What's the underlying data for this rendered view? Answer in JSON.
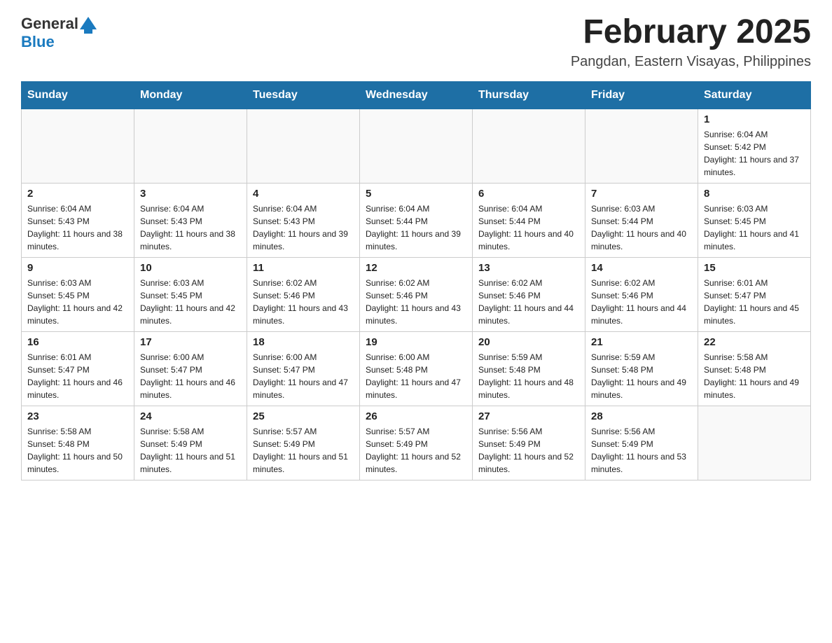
{
  "header": {
    "logo_general": "General",
    "logo_blue": "Blue",
    "title": "February 2025",
    "subtitle": "Pangdan, Eastern Visayas, Philippines"
  },
  "days_of_week": [
    "Sunday",
    "Monday",
    "Tuesday",
    "Wednesday",
    "Thursday",
    "Friday",
    "Saturday"
  ],
  "weeks": [
    {
      "days": [
        {
          "num": "",
          "info": ""
        },
        {
          "num": "",
          "info": ""
        },
        {
          "num": "",
          "info": ""
        },
        {
          "num": "",
          "info": ""
        },
        {
          "num": "",
          "info": ""
        },
        {
          "num": "",
          "info": ""
        },
        {
          "num": "1",
          "info": "Sunrise: 6:04 AM\nSunset: 5:42 PM\nDaylight: 11 hours and 37 minutes."
        }
      ]
    },
    {
      "days": [
        {
          "num": "2",
          "info": "Sunrise: 6:04 AM\nSunset: 5:43 PM\nDaylight: 11 hours and 38 minutes."
        },
        {
          "num": "3",
          "info": "Sunrise: 6:04 AM\nSunset: 5:43 PM\nDaylight: 11 hours and 38 minutes."
        },
        {
          "num": "4",
          "info": "Sunrise: 6:04 AM\nSunset: 5:43 PM\nDaylight: 11 hours and 39 minutes."
        },
        {
          "num": "5",
          "info": "Sunrise: 6:04 AM\nSunset: 5:44 PM\nDaylight: 11 hours and 39 minutes."
        },
        {
          "num": "6",
          "info": "Sunrise: 6:04 AM\nSunset: 5:44 PM\nDaylight: 11 hours and 40 minutes."
        },
        {
          "num": "7",
          "info": "Sunrise: 6:03 AM\nSunset: 5:44 PM\nDaylight: 11 hours and 40 minutes."
        },
        {
          "num": "8",
          "info": "Sunrise: 6:03 AM\nSunset: 5:45 PM\nDaylight: 11 hours and 41 minutes."
        }
      ]
    },
    {
      "days": [
        {
          "num": "9",
          "info": "Sunrise: 6:03 AM\nSunset: 5:45 PM\nDaylight: 11 hours and 42 minutes."
        },
        {
          "num": "10",
          "info": "Sunrise: 6:03 AM\nSunset: 5:45 PM\nDaylight: 11 hours and 42 minutes."
        },
        {
          "num": "11",
          "info": "Sunrise: 6:02 AM\nSunset: 5:46 PM\nDaylight: 11 hours and 43 minutes."
        },
        {
          "num": "12",
          "info": "Sunrise: 6:02 AM\nSunset: 5:46 PM\nDaylight: 11 hours and 43 minutes."
        },
        {
          "num": "13",
          "info": "Sunrise: 6:02 AM\nSunset: 5:46 PM\nDaylight: 11 hours and 44 minutes."
        },
        {
          "num": "14",
          "info": "Sunrise: 6:02 AM\nSunset: 5:46 PM\nDaylight: 11 hours and 44 minutes."
        },
        {
          "num": "15",
          "info": "Sunrise: 6:01 AM\nSunset: 5:47 PM\nDaylight: 11 hours and 45 minutes."
        }
      ]
    },
    {
      "days": [
        {
          "num": "16",
          "info": "Sunrise: 6:01 AM\nSunset: 5:47 PM\nDaylight: 11 hours and 46 minutes."
        },
        {
          "num": "17",
          "info": "Sunrise: 6:00 AM\nSunset: 5:47 PM\nDaylight: 11 hours and 46 minutes."
        },
        {
          "num": "18",
          "info": "Sunrise: 6:00 AM\nSunset: 5:47 PM\nDaylight: 11 hours and 47 minutes."
        },
        {
          "num": "19",
          "info": "Sunrise: 6:00 AM\nSunset: 5:48 PM\nDaylight: 11 hours and 47 minutes."
        },
        {
          "num": "20",
          "info": "Sunrise: 5:59 AM\nSunset: 5:48 PM\nDaylight: 11 hours and 48 minutes."
        },
        {
          "num": "21",
          "info": "Sunrise: 5:59 AM\nSunset: 5:48 PM\nDaylight: 11 hours and 49 minutes."
        },
        {
          "num": "22",
          "info": "Sunrise: 5:58 AM\nSunset: 5:48 PM\nDaylight: 11 hours and 49 minutes."
        }
      ]
    },
    {
      "days": [
        {
          "num": "23",
          "info": "Sunrise: 5:58 AM\nSunset: 5:48 PM\nDaylight: 11 hours and 50 minutes."
        },
        {
          "num": "24",
          "info": "Sunrise: 5:58 AM\nSunset: 5:49 PM\nDaylight: 11 hours and 51 minutes."
        },
        {
          "num": "25",
          "info": "Sunrise: 5:57 AM\nSunset: 5:49 PM\nDaylight: 11 hours and 51 minutes."
        },
        {
          "num": "26",
          "info": "Sunrise: 5:57 AM\nSunset: 5:49 PM\nDaylight: 11 hours and 52 minutes."
        },
        {
          "num": "27",
          "info": "Sunrise: 5:56 AM\nSunset: 5:49 PM\nDaylight: 11 hours and 52 minutes."
        },
        {
          "num": "28",
          "info": "Sunrise: 5:56 AM\nSunset: 5:49 PM\nDaylight: 11 hours and 53 minutes."
        },
        {
          "num": "",
          "info": ""
        }
      ]
    }
  ]
}
